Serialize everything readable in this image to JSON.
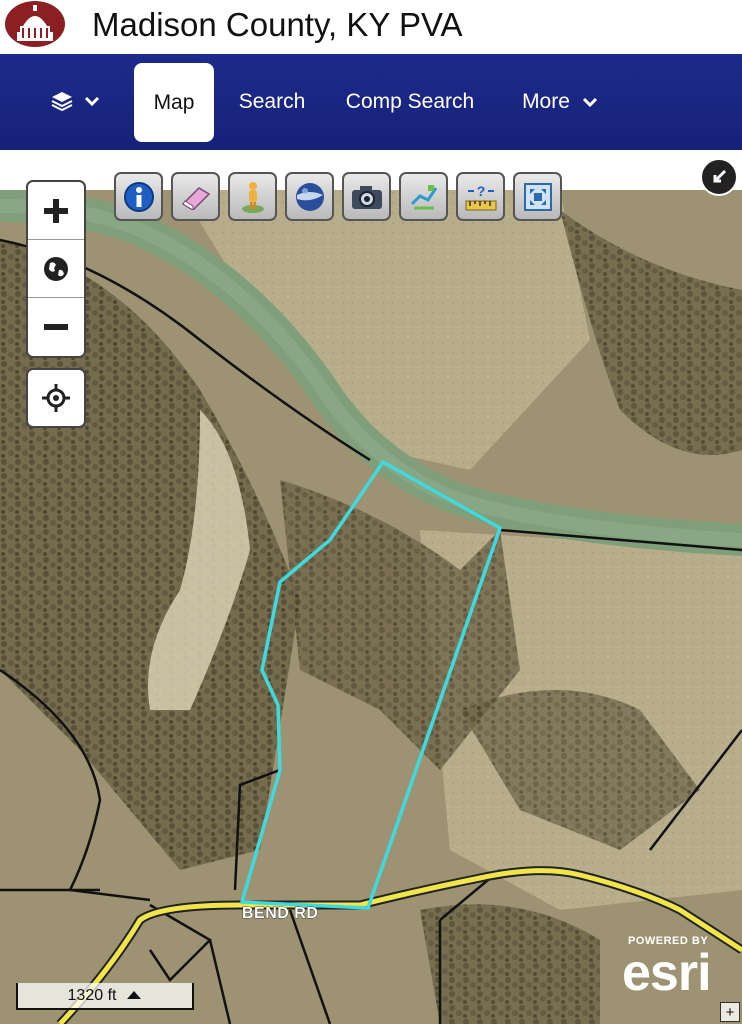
{
  "header": {
    "title": "Madison County, KY PVA",
    "logo_icon": "courthouse-dome-logo-icon"
  },
  "nav": {
    "layers_icon": "layers-icon",
    "items": [
      {
        "label": "Map",
        "active": true
      },
      {
        "label": "Search"
      },
      {
        "label": "Comp Search"
      },
      {
        "label": "More",
        "icon": "chevron-down-icon"
      }
    ]
  },
  "map": {
    "zoom_controls": [
      "zoom-in-icon",
      "globe-icon",
      "zoom-out-icon"
    ],
    "locate_icon": "crosshair-icon",
    "toolbar_icons": [
      "info-icon",
      "eraser-icon",
      "street-view-icon",
      "globe-ball-icon",
      "camera-icon",
      "draw-icon",
      "measure-icon",
      "fullscreen-icon"
    ],
    "collapse_icon": "collapse-arrow-icon",
    "road_label": "BEND RD",
    "scale_label": "1320 ft",
    "attribution_small": "POWERED BY",
    "attribution_brand": "esri",
    "parcel_outline_color": "#3fdadf",
    "road_color": "#f0e64a",
    "river_color": "#7f9e7a"
  }
}
